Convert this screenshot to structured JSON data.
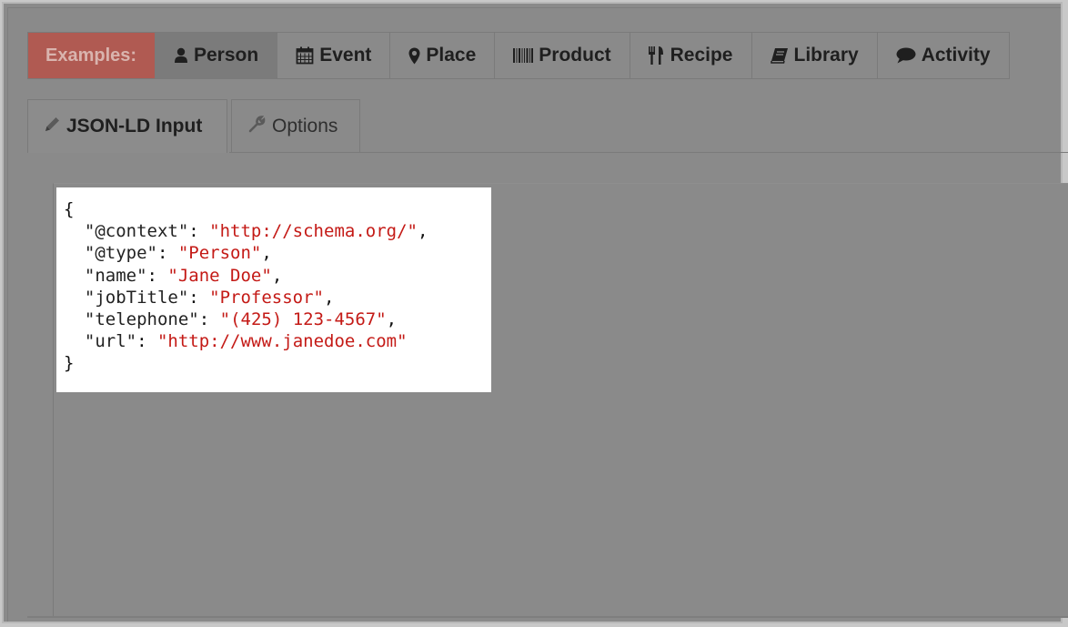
{
  "examples": {
    "label": "Examples:",
    "buttons": [
      {
        "label": "Person",
        "icon": "user-icon"
      },
      {
        "label": "Event",
        "icon": "calendar-icon"
      },
      {
        "label": "Place",
        "icon": "map-marker-icon"
      },
      {
        "label": "Product",
        "icon": "barcode-icon"
      },
      {
        "label": "Recipe",
        "icon": "cutlery-icon"
      },
      {
        "label": "Library",
        "icon": "book-icon"
      },
      {
        "label": "Activity",
        "icon": "comment-icon"
      }
    ]
  },
  "tabs": [
    {
      "label": "JSON-LD Input",
      "icon": "pencil-icon",
      "active": true
    },
    {
      "label": "Options",
      "icon": "wrench-icon",
      "active": false
    }
  ],
  "editor": {
    "lines": [
      {
        "open": "{"
      },
      {
        "key": "\"@context\"",
        "value": "\"http://schema.org/\"",
        "comma": ","
      },
      {
        "key": "\"@type\"",
        "value": "\"Person\"",
        "comma": ","
      },
      {
        "key": "\"name\"",
        "value": "\"Jane Doe\"",
        "comma": ","
      },
      {
        "key": "\"jobTitle\"",
        "value": "\"Professor\"",
        "comma": ","
      },
      {
        "key": "\"telephone\"",
        "value": "\"(425) 123-4567\"",
        "comma": ","
      },
      {
        "key": "\"url\"",
        "value": "\"http://www.janedoe.com\"",
        "comma": ""
      },
      {
        "close": "}"
      }
    ]
  },
  "colors": {
    "examples_label_bg": "#b05a52",
    "string_value": "#c41a16"
  }
}
